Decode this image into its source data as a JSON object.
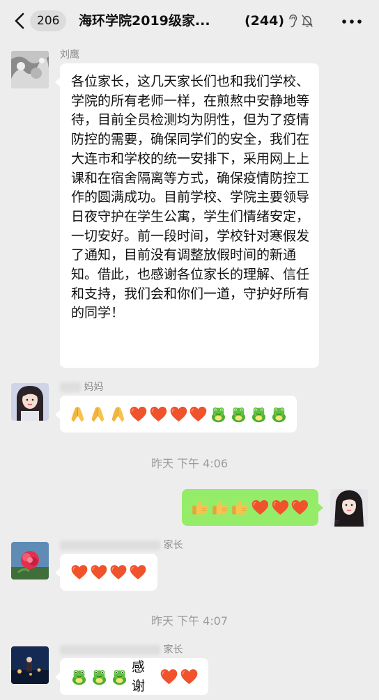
{
  "header": {
    "back_count": "206",
    "title": "海环学院2019级家...",
    "member_count": "(244)",
    "icons": [
      "back-icon",
      "ear-icon",
      "mute-bell-icon",
      "more-icon"
    ]
  },
  "messages": [
    {
      "sender": "刘鹰",
      "text": "各位家长，这几天家长们也和我们学校、学院的所有老师一样，在煎熬中安静地等待，目前全员检测均为阴性，但为了疫情防控的需要，确保同学们的安全，我们在大连市和学校的统一安排下，采用网上上课和在宿舍隔离等方式，确保疫情防控工作的圆满成功。目前学校、学院主要领导日夜守护在学生公寓，学生们情绪安定，一切安好。前一段时间，学校针对寒假发了通知，目前没有调整放假时间的新通知。借此，也感谢各位家长的理解、信任和支持，我们会和你们一道，守护好所有的同学！"
    },
    {
      "sender_suffix": "妈妈",
      "emojis": [
        "folded-hands",
        "folded-hands",
        "folded-hands",
        "heart",
        "heart",
        "heart",
        "heart",
        "frog",
        "frog",
        "frog",
        "frog"
      ]
    },
    {
      "timestamp": "昨天 下午 4:06"
    },
    {
      "self": true,
      "emojis": [
        "thumbs-up",
        "thumbs-up",
        "thumbs-up",
        "heart",
        "heart",
        "heart"
      ]
    },
    {
      "sender_suffix": "家长",
      "emojis": [
        "heart",
        "heart",
        "heart",
        "heart"
      ]
    },
    {
      "timestamp": "昨天 下午 4:07"
    },
    {
      "sender_suffix": "家长",
      "emojis_before": [
        "frog",
        "frog",
        "frog"
      ],
      "text": "感谢",
      "emojis_after": [
        "heart",
        "heart"
      ]
    }
  ],
  "colors": {
    "background": "#ededed",
    "self_bubble": "#95ec69",
    "other_bubble": "#ffffff",
    "heart": "#f0522c",
    "frog": "#4caf2f",
    "hands": "#f3b53b"
  }
}
